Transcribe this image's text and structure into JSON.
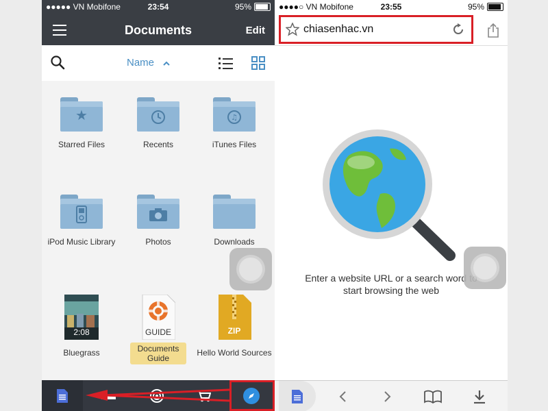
{
  "left": {
    "status": {
      "carrier": "●●●●● VN Mobifone",
      "time": "23:54",
      "battery": "95%"
    },
    "title": "Documents",
    "edit_label": "Edit",
    "sort_label": "Name",
    "items": [
      {
        "label": "Starred Files",
        "icon": "star-icon"
      },
      {
        "label": "Recents",
        "icon": "clock-icon"
      },
      {
        "label": "iTunes Files",
        "icon": "music-icon"
      },
      {
        "label": "iPod Music Library",
        "icon": "ipod-icon"
      },
      {
        "label": "Photos",
        "icon": "camera-icon"
      },
      {
        "label": "Downloads",
        "icon": "download-icon"
      },
      {
        "label": "Bluegrass",
        "badge": "2:08"
      },
      {
        "label": "Documents Guide",
        "badge": "GUIDE"
      },
      {
        "label": "Hello World Sources",
        "badge": "ZIP"
      }
    ],
    "tabs": [
      "documents-tab",
      "connect-tab",
      "wifi-tab",
      "store-tab",
      "browser-tab"
    ]
  },
  "right": {
    "status": {
      "carrier": "●●●●○ VN Mobifone",
      "time": "23:55",
      "battery": "95%"
    },
    "url": "chiasenhac.vn",
    "hint_line1": "Enter a website URL or a search word to",
    "hint_line2": "start browsing the web"
  },
  "colors": {
    "accent": "#4a8fc4",
    "highlight_box": "#d91f26",
    "nav_dark": "#3a3e44",
    "tab_dark": "#343840"
  }
}
